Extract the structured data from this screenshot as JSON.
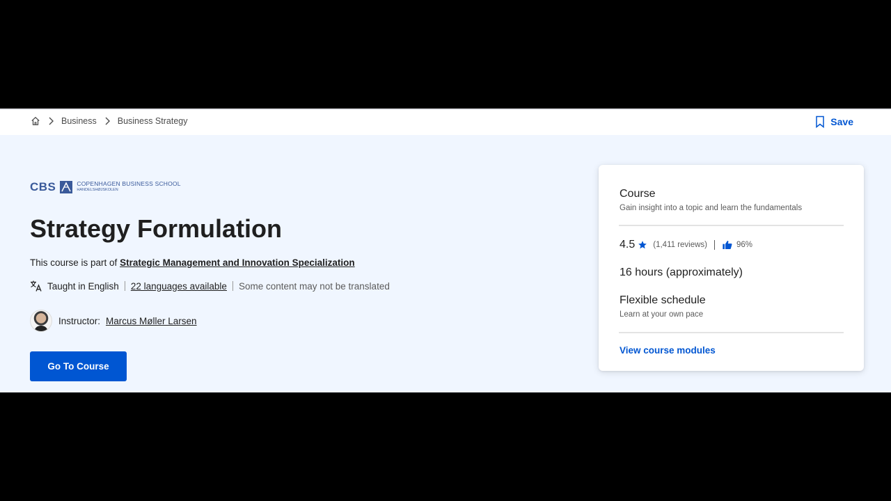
{
  "breadcrumb": {
    "items": [
      "Business",
      "Business Strategy"
    ]
  },
  "header": {
    "save_label": "Save"
  },
  "logo": {
    "abbr": "CBS",
    "line1": "COPENHAGEN BUSINESS SCHOOL",
    "line2": "HANDELSHØJSKOLEN"
  },
  "course": {
    "title": "Strategy Formulation",
    "part_of_prefix": "This course is part of ",
    "specialization": "Strategic Management and Innovation Specialization",
    "taught_in": "Taught in English",
    "languages_link": "22 languages available",
    "translation_note": "Some content may not be translated",
    "instructor_label": "Instructor:",
    "instructor_name": "Marcus Møller Larsen",
    "cta_label": "Go To Course"
  },
  "card": {
    "type": "Course",
    "type_desc": "Gain insight into a topic and learn the fundamentals",
    "rating": "4.5",
    "reviews": "(1,411 reviews)",
    "approval": "96%",
    "duration": "16 hours (approximately)",
    "schedule": "Flexible schedule",
    "schedule_desc": "Learn at your own pace",
    "modules_link": "View course modules"
  },
  "colors": {
    "accent": "#0056d2",
    "hero_bg": "#f0f6ff"
  }
}
